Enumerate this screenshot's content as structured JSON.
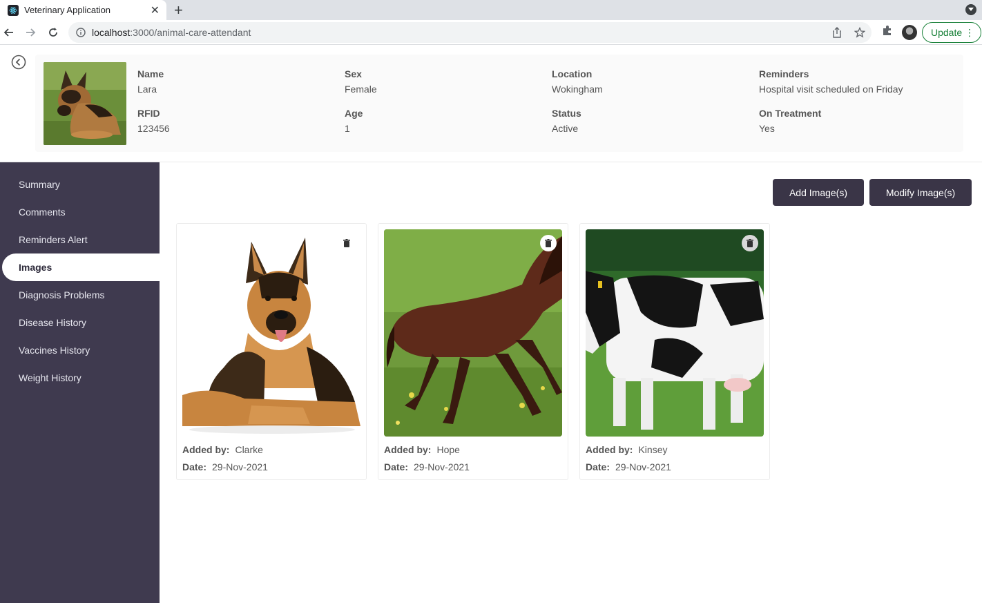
{
  "browser": {
    "tab_title": "Veterinary Application",
    "url_host": "localhost",
    "url_path": ":3000/animal-care-attendant",
    "update_label": "Update"
  },
  "patient": {
    "fields": [
      {
        "label": "Name",
        "value": "Lara"
      },
      {
        "label": "RFID",
        "value": "123456"
      },
      {
        "label": "Sex",
        "value": "Female"
      },
      {
        "label": "Age",
        "value": "1"
      },
      {
        "label": "Location",
        "value": "Wokingham"
      },
      {
        "label": "Status",
        "value": "Active"
      },
      {
        "label": "Reminders",
        "value": "Hospital visit scheduled on Friday"
      },
      {
        "label": "On Treatment",
        "value": "Yes"
      }
    ]
  },
  "sidebar": {
    "items": [
      {
        "label": "Summary"
      },
      {
        "label": "Comments"
      },
      {
        "label": "Reminders Alert"
      },
      {
        "label": "Images",
        "active": true
      },
      {
        "label": "Diagnosis Problems"
      },
      {
        "label": "Disease History"
      },
      {
        "label": "Vaccines History"
      },
      {
        "label": "Weight History"
      }
    ]
  },
  "actions": {
    "add_label": "Add Image(s)",
    "modify_label": "Modify Image(s)"
  },
  "images": [
    {
      "added_by_label": "Added by:",
      "added_by": "Clarke",
      "date_label": "Date:",
      "date": "29-Nov-2021",
      "subject": "dog"
    },
    {
      "added_by_label": "Added by:",
      "added_by": "Hope",
      "date_label": "Date:",
      "date": "29-Nov-2021",
      "subject": "horse"
    },
    {
      "added_by_label": "Added by:",
      "added_by": "Kinsey",
      "date_label": "Date:",
      "date": "29-Nov-2021",
      "subject": "cow"
    }
  ],
  "colors": {
    "sidebar_bg": "#3f3a4f",
    "button_bg": "#3a3547",
    "update_green": "#188038"
  }
}
